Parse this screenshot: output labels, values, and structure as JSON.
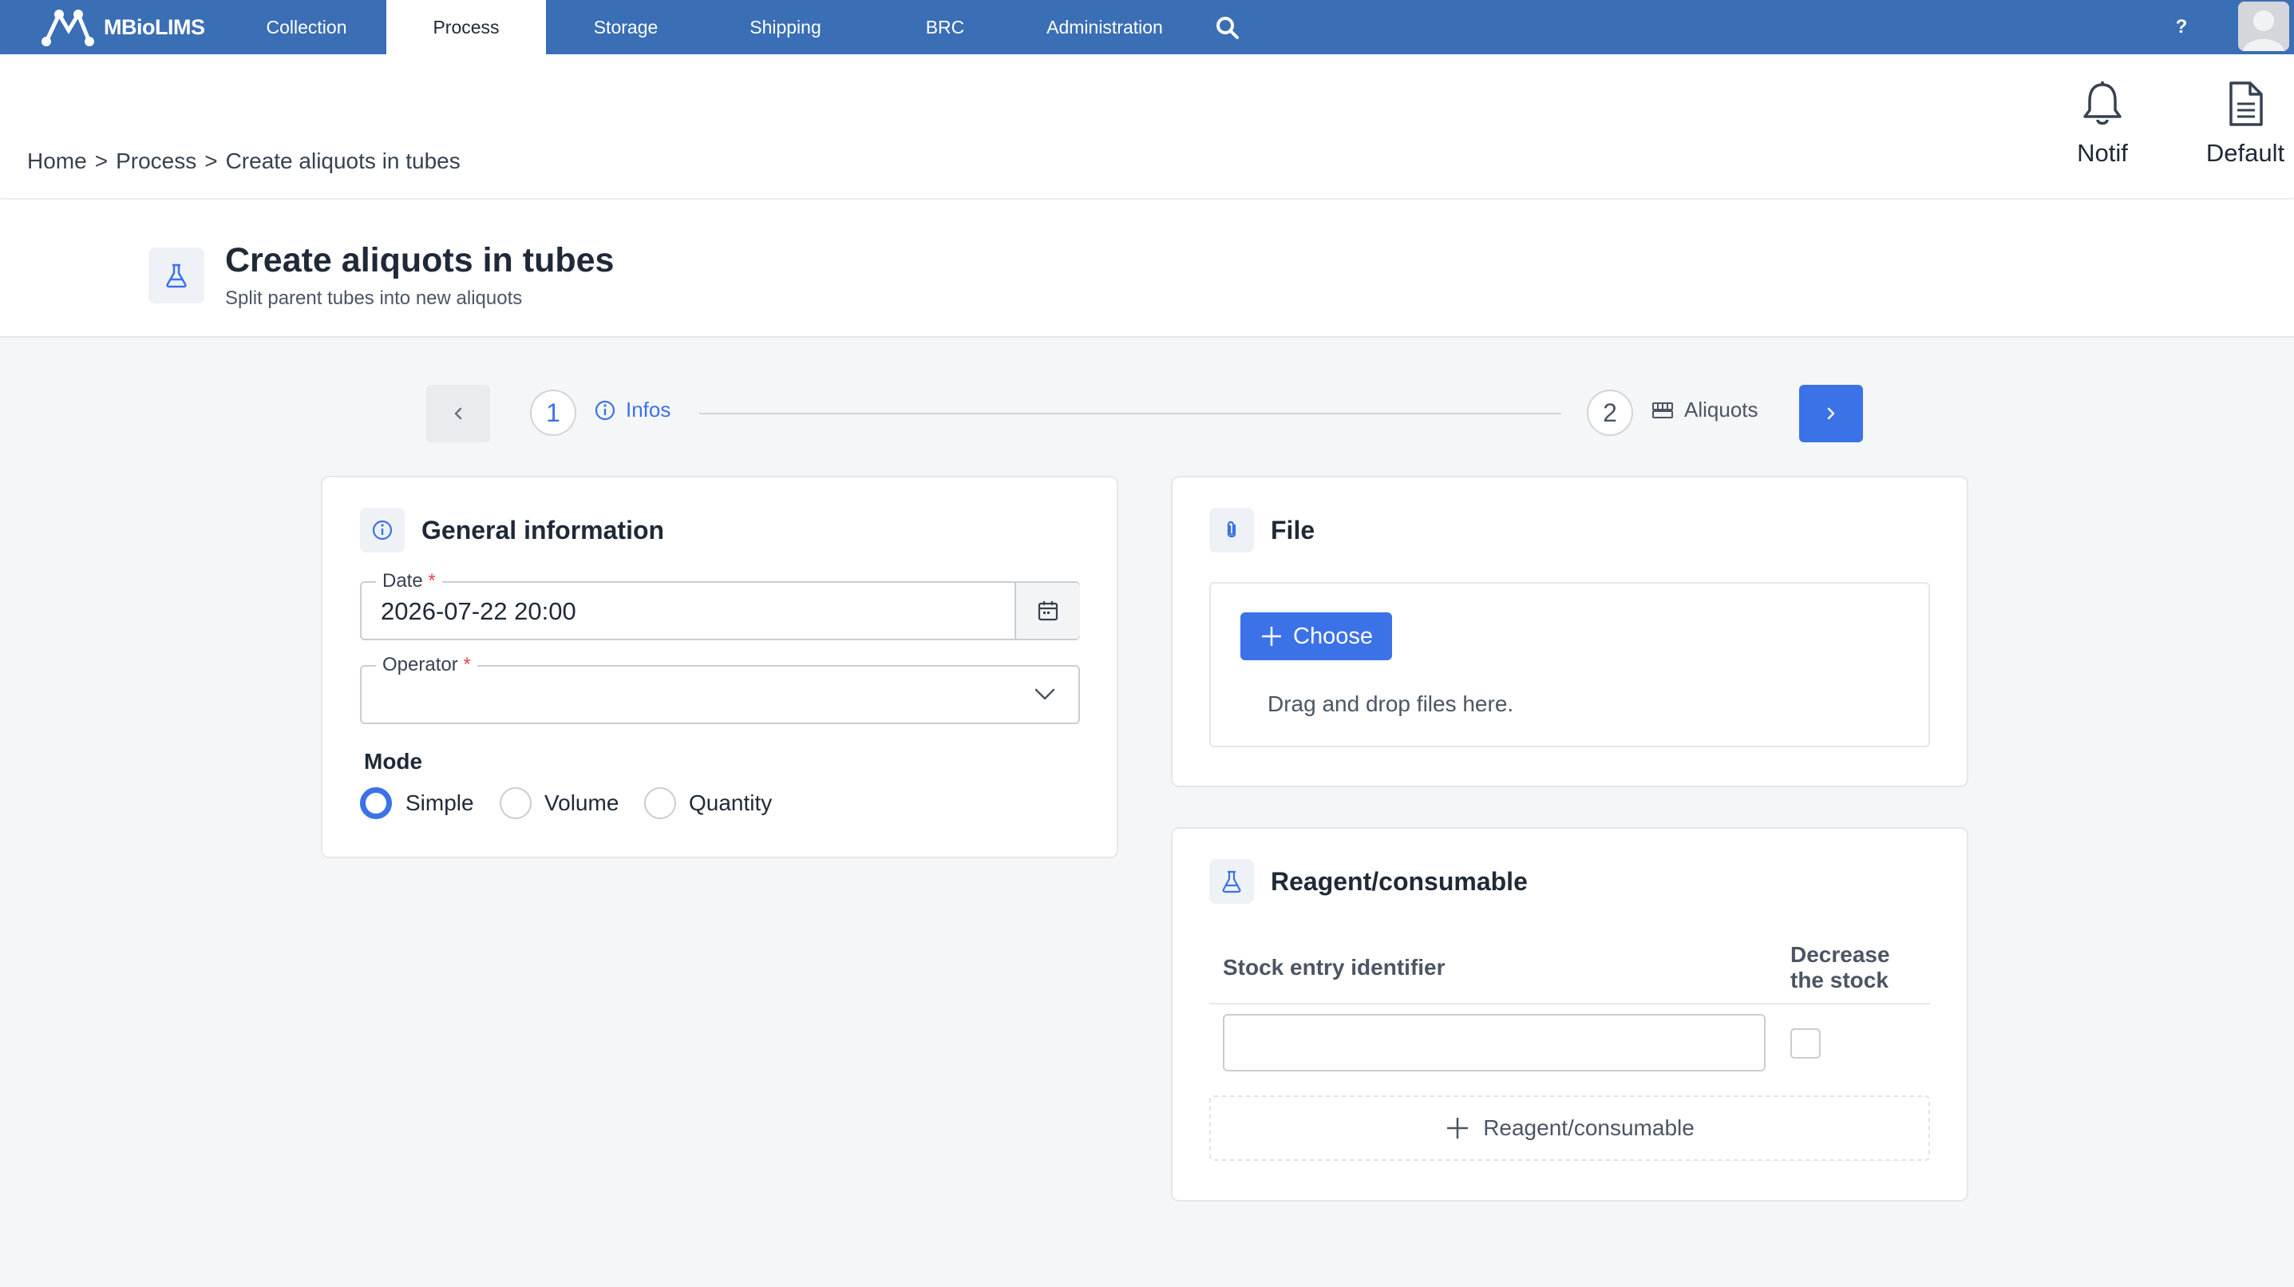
{
  "app": {
    "logo_text": "MBioLIMS"
  },
  "nav": {
    "items": [
      {
        "label": "Collection",
        "active": false
      },
      {
        "label": "Process",
        "active": true
      },
      {
        "label": "Storage",
        "active": false
      },
      {
        "label": "Shipping",
        "active": false
      },
      {
        "label": "BRC",
        "active": false
      },
      {
        "label": "Administration",
        "active": false
      }
    ],
    "search_icon": "search-icon",
    "help_label": "?",
    "avatar_icon": "user-avatar"
  },
  "breadcrumb": [
    "Home",
    ">",
    "Process",
    ">",
    "Create aliquots in tubes"
  ],
  "header_tools": {
    "notif_label": "Notif",
    "notif_icon": "bell-icon",
    "default_label": "Default",
    "default_icon": "document-icon"
  },
  "page": {
    "title": "Create aliquots in tubes",
    "subtitle": "Split parent tubes into new aliquots",
    "icon": "flask-icon"
  },
  "stepper": {
    "steps": [
      {
        "number": "1",
        "label": "Infos",
        "icon": "info-icon",
        "active": true
      },
      {
        "number": "2",
        "label": "Aliquots",
        "icon": "tubes-icon",
        "active": false
      }
    ]
  },
  "general_info": {
    "title": "General information",
    "date_label": "Date",
    "date_value": "2026-07-22 20:00",
    "operator_label": "Operator",
    "operator_value": "",
    "required_mark": "*",
    "mode_label": "Mode",
    "mode_options": [
      "Simple",
      "Volume",
      "Quantity"
    ],
    "mode_selected": "Simple"
  },
  "file": {
    "title": "File",
    "choose_label": "Choose",
    "drop_hint": "Drag and drop files here."
  },
  "reagent": {
    "title": "Reagent/consumable",
    "col_identifier": "Stock entry identifier",
    "col_decrease_line1": "Decrease",
    "col_decrease_line2": "the stock",
    "stock_value": "",
    "decrease_checked": false,
    "add_label": "Reagent/consumable"
  },
  "colors": {
    "nav_bg": "#3a6eb5",
    "accent": "#3b72e8",
    "page_bg": "#f5f6f8"
  }
}
